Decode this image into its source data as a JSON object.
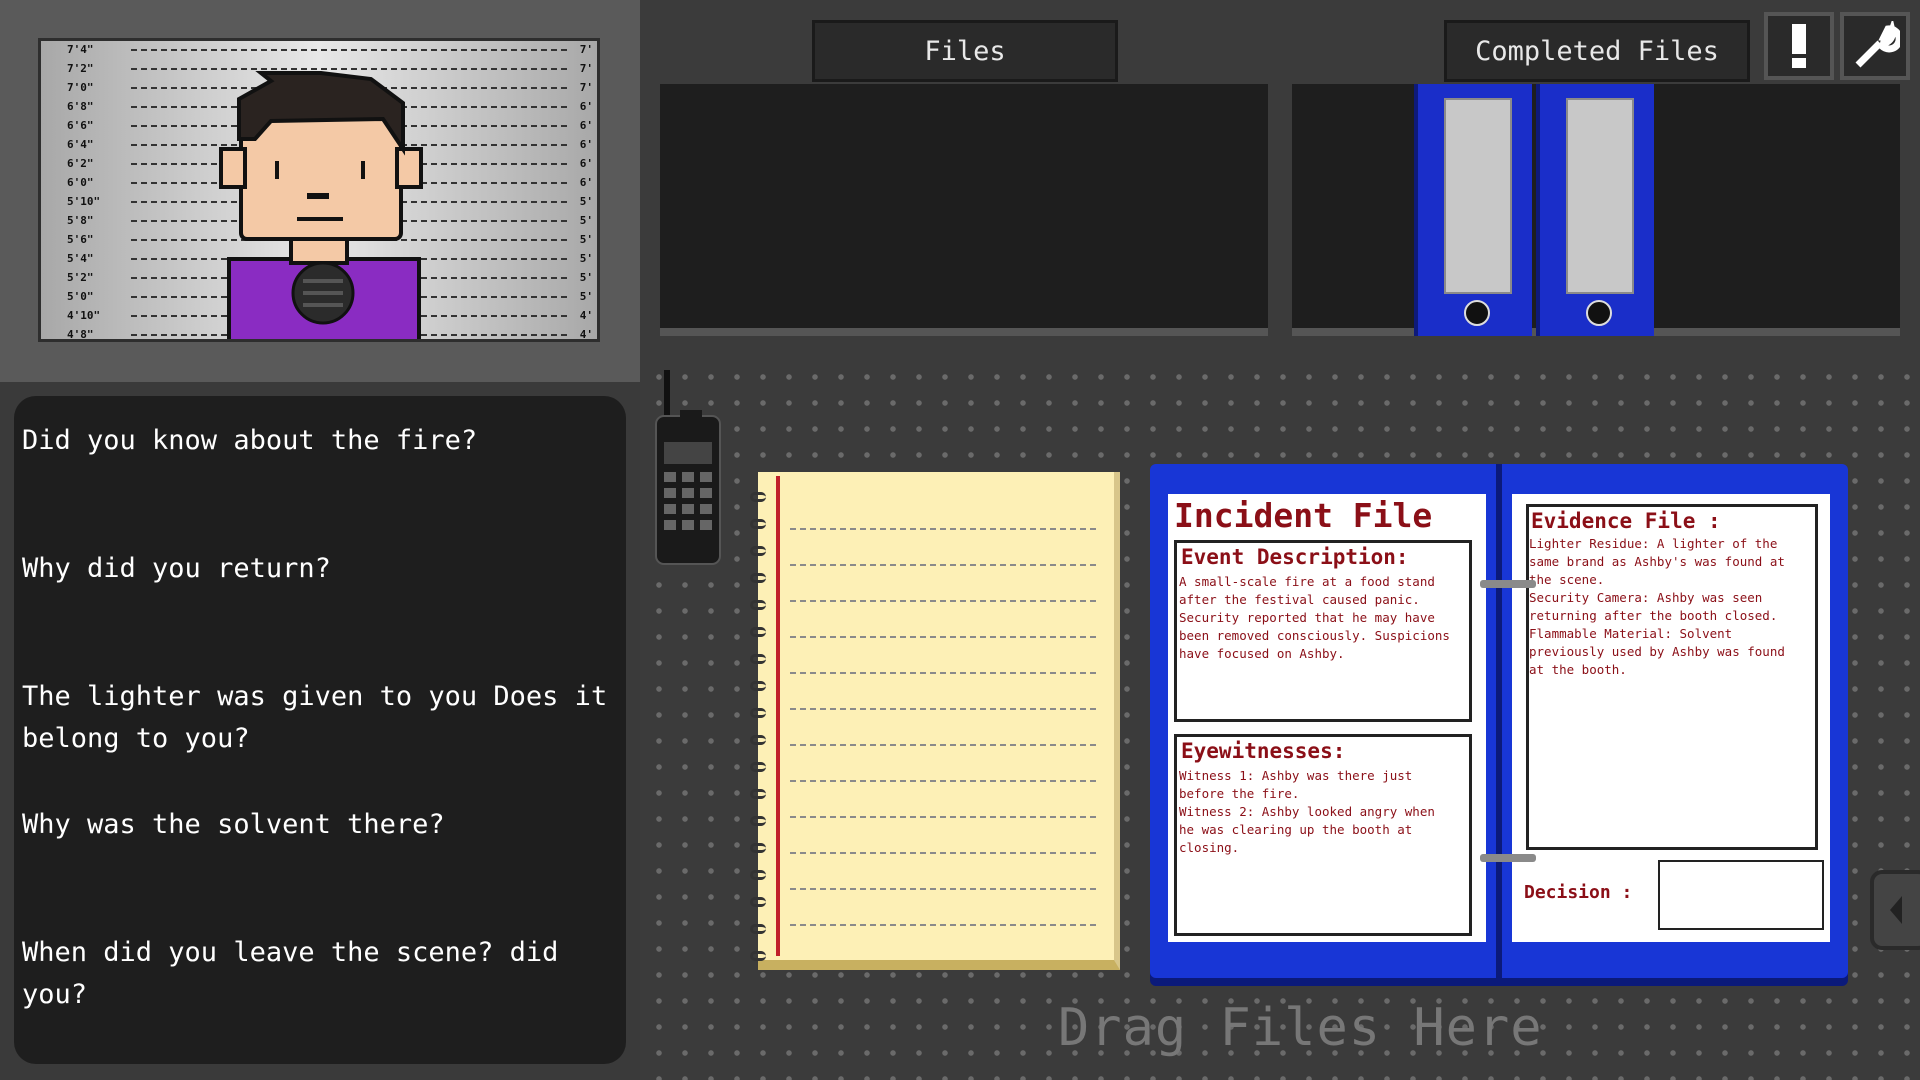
{
  "portrait": {
    "height_marks": [
      "7'4\"",
      "7'2\"",
      "7'0\"",
      "6'8\"",
      "6'6\"",
      "6'4\"",
      "6'2\"",
      "6'0\"",
      "5'10\"",
      "5'8\"",
      "5'6\"",
      "5'4\"",
      "5'2\"",
      "5'0\"",
      "4'10\"",
      "4'8\""
    ],
    "height_marks_right": [
      "7'",
      "7'",
      "7'",
      "6'",
      "6'",
      "6'",
      "6'",
      "6'",
      "5'",
      "5'",
      "5'",
      "5'",
      "5'",
      "5'",
      "4'",
      "4'"
    ]
  },
  "questions": [
    "Did you know about the fire?",
    "Why did you return?",
    "The lighter was given to you Does it belong to you?",
    "Why was the solvent there?",
    "When did you leave the scene? did you?"
  ],
  "tabs": {
    "files": "Files",
    "completed": "Completed Files"
  },
  "buttons": {
    "alert": "alert-icon",
    "settings": "wrench-icon"
  },
  "incident": {
    "title": "Incident File",
    "event_heading": "Event Description:",
    "event_text": "A small-scale fire at a food stand\nafter the festival caused panic.\nSecurity reported that he may have\nbeen removed consciously. Suspicions\nhave focused on Ashby.",
    "witness_heading": "Eyewitnesses:",
    "witness_text": "Witness 1: Ashby was there just\nbefore the fire.\nWitness 2: Ashby looked angry when\nhe was clearing up the booth at\nclosing."
  },
  "evidence": {
    "heading": "Evidence File :",
    "text": "Lighter Residue: A lighter of the\nsame brand as Ashby's was found at\nthe scene.\nSecurity Camera: Ashby was seen\nreturning after the booth closed.\nFlammable Material: Solvent\npreviously used by Ashby was found\nat the booth.",
    "decision_label": "Decision :",
    "decision_value": ""
  },
  "drop_zone": "Drag Files Here",
  "colors": {
    "folder": "#1836d6",
    "accent_red": "#8b0f17",
    "notepad": "#fdf0b6"
  }
}
